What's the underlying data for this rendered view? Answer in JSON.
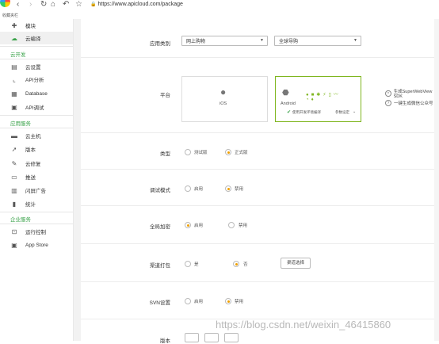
{
  "browser": {
    "url": "https://www.apicloud.com/package",
    "bookmark": "收藏夹栏"
  },
  "sidebar": {
    "items_top": [
      {
        "label": "模块",
        "icon": "puzzle-icon"
      },
      {
        "label": "云编译",
        "icon": "cloud-icon",
        "active": true
      }
    ],
    "section_dev": "云开发",
    "items_dev": [
      {
        "label": "云设置",
        "icon": "gear-icon"
      },
      {
        "label": "API分析",
        "icon": "chart-icon"
      },
      {
        "label": "Database",
        "icon": "database-icon"
      },
      {
        "label": "API调试",
        "icon": "bug-icon"
      }
    ],
    "section_ops": "应用服务",
    "items_ops": [
      {
        "label": "云主机",
        "icon": "server-icon"
      },
      {
        "label": "版本",
        "icon": "rocket-icon"
      },
      {
        "label": "云修复",
        "icon": "wrench-icon"
      },
      {
        "label": "推送",
        "icon": "send-icon"
      },
      {
        "label": "闪屏广告",
        "icon": "screen-icon"
      },
      {
        "label": "统计",
        "icon": "stats-icon"
      }
    ],
    "section_ent": "企业服务",
    "items_ent": [
      {
        "label": "运行控制",
        "icon": "control-icon"
      },
      {
        "label": "App Store",
        "icon": "store-icon"
      }
    ]
  },
  "form": {
    "app_category_label": "应用类别",
    "category_value": "网上购物",
    "nav_value": "全球导购",
    "platform_label": "平台",
    "ios_label": "iOS",
    "android_label": "Android",
    "android_option": "使用开发环境编译",
    "android_params": "参数设定",
    "help_superwebview": "生成SuperWebView SDK",
    "help_wechat": "一键生成微信公众号",
    "type_label": "类型",
    "type_test": "测试版",
    "type_release": "正式版",
    "debug_label": "调试模式",
    "debug_on": "启用",
    "debug_off": "禁用",
    "encrypt_label": "全局加密",
    "encrypt_on": "启用",
    "encrypt_off": "禁用",
    "channel_label": "渠道打包",
    "channel_yes": "是",
    "channel_no": "否",
    "channel_button": "渠道选择",
    "svn_label": "SVN设置",
    "svn_on": "启用",
    "svn_off": "禁用",
    "next_label": "版本"
  },
  "watermark": "https://blog.csdn.net/weixin_46415860"
}
